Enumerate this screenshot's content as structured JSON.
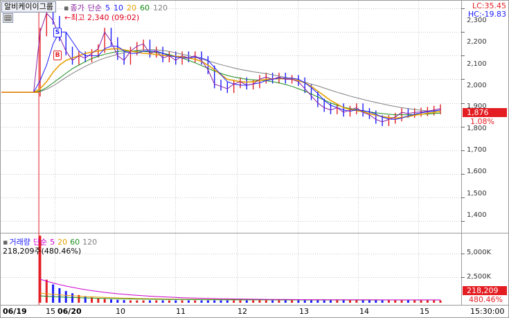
{
  "stock_name": "알비케이이그룹",
  "legend": {
    "main": "종가",
    "ma_type": "단순",
    "periods": [
      {
        "label": "5",
        "color": "#1a1aff"
      },
      {
        "label": "10",
        "color": "#1a1aff"
      },
      {
        "label": "20",
        "color": "#e6a000"
      },
      {
        "label": "60",
        "color": "#1a8c1a"
      },
      {
        "label": "120",
        "color": "#808080"
      }
    ],
    "main_color": "#8a1fa0"
  },
  "volume_legend": {
    "main": "거래량",
    "ma_type": "단순",
    "periods": [
      {
        "label": "5",
        "color": "#cc00cc"
      },
      {
        "label": "20",
        "color": "#e6a000"
      },
      {
        "label": "60",
        "color": "#1a8c1a"
      },
      {
        "label": "120",
        "color": "#808080"
      }
    ],
    "info": "218,209주(480.46%)"
  },
  "high_marker": "최고 2,340 (09:02)",
  "badges": {
    "sell": "S",
    "buy": "B"
  },
  "lc": "LC:35.45",
  "hc": "HC:-19.83",
  "price_axis": [
    "2,300",
    "2,200",
    "2,100",
    "2,000",
    "1,900",
    "1,800",
    "1,700",
    "1,600",
    "1,500",
    "1,400"
  ],
  "price_tag": {
    "value": "1,876",
    "change": "1.08%"
  },
  "volume_axis": [
    "5,000K",
    "2,500K"
  ],
  "volume_tag": {
    "value": "218,209",
    "change": "480.46%"
  },
  "x_axis": [
    {
      "label": "06/19",
      "bold": true
    },
    {
      "label": "15",
      "bold": false
    },
    {
      "label": "06/20",
      "bold": true
    },
    {
      "label": "10",
      "bold": false
    },
    {
      "label": "11",
      "bold": false
    },
    {
      "label": "12",
      "bold": false
    },
    {
      "label": "13",
      "bold": false
    },
    {
      "label": "14",
      "bold": false
    },
    {
      "label": "15",
      "bold": false
    }
  ],
  "clock": "15:30:00",
  "colors": {
    "up": "#e41d22",
    "down": "#1a1aff",
    "grid": "#c8c8c8",
    "axis": "#666666"
  },
  "chart_data": {
    "type": "line",
    "title": "",
    "ylim": [
      1350,
      2330
    ],
    "close": [
      1945,
      1945,
      1945,
      1945,
      1945,
      1945,
      2200,
      2280,
      2250,
      2180,
      2120,
      2080,
      2100,
      2090,
      2110,
      2130,
      2200,
      2160,
      2100,
      2080,
      2120,
      2140,
      2150,
      2110,
      2120,
      2090,
      2100,
      2080,
      2100,
      2090,
      2100,
      2080,
      2040,
      1980,
      1970,
      1960,
      1980,
      1990,
      1975,
      1980,
      2000,
      2010,
      2000,
      2010,
      2000,
      2000,
      1990,
      1960,
      1930,
      1900,
      1880,
      1870,
      1880,
      1860,
      1870,
      1880,
      1860,
      1850,
      1830,
      1820,
      1830,
      1840,
      1860,
      1855,
      1860,
      1862,
      1865,
      1870,
      1876
    ],
    "ma5": [
      1945,
      1945,
      1945,
      1945,
      1945,
      1945,
      1995,
      2060,
      2150,
      2200,
      2200,
      2160,
      2120,
      2100,
      2100,
      2100,
      2130,
      2140,
      2140,
      2120,
      2110,
      2110,
      2120,
      2120,
      2120,
      2110,
      2100,
      2095,
      2090,
      2090,
      2095,
      2090,
      2080,
      2050,
      2020,
      1990,
      1980,
      1975,
      1975,
      1980,
      1985,
      1995,
      2000,
      2005,
      2005,
      2005,
      2000,
      1985,
      1965,
      1940,
      1910,
      1890,
      1880,
      1870,
      1865,
      1870,
      1868,
      1862,
      1852,
      1840,
      1832,
      1830,
      1836,
      1845,
      1852,
      1858,
      1862,
      1866,
      1870
    ],
    "ma20": [
      1945,
      1945,
      1945,
      1945,
      1945,
      1945,
      1960,
      1990,
      2030,
      2060,
      2080,
      2090,
      2100,
      2110,
      2115,
      2120,
      2125,
      2128,
      2130,
      2125,
      2120,
      2115,
      2110,
      2108,
      2105,
      2102,
      2100,
      2098,
      2095,
      2090,
      2085,
      2075,
      2060,
      2040,
      2020,
      2000,
      1995,
      1990,
      1988,
      1990,
      1995,
      2000,
      2002,
      2003,
      2002,
      2000,
      1995,
      1985,
      1970,
      1950,
      1930,
      1910,
      1895,
      1880,
      1872,
      1868,
      1862,
      1855,
      1848,
      1842,
      1838,
      1836,
      1838,
      1842,
      1848,
      1852,
      1856,
      1860,
      1864
    ],
    "ma60": [
      1945,
      1945,
      1945,
      1945,
      1945,
      1945,
      1950,
      1965,
      1985,
      2005,
      2025,
      2045,
      2060,
      2075,
      2088,
      2098,
      2106,
      2112,
      2118,
      2120,
      2120,
      2120,
      2118,
      2116,
      2114,
      2110,
      2105,
      2098,
      2090,
      2080,
      2070,
      2058,
      2046,
      2035,
      2025,
      2016,
      2010,
      2005,
      2000,
      1998,
      1996,
      1994,
      1990,
      1985,
      1978,
      1970,
      1960,
      1950,
      1938,
      1925,
      1912,
      1900,
      1890,
      1882,
      1876,
      1872,
      1866,
      1862,
      1858,
      1855,
      1852,
      1850,
      1850,
      1850,
      1851,
      1852,
      1853,
      1855,
      1857
    ],
    "ma120": [
      1945,
      1945,
      1945,
      1945,
      1945,
      1945,
      1948,
      1958,
      1972,
      1990,
      2008,
      2025,
      2040,
      2055,
      2068,
      2080,
      2090,
      2098,
      2106,
      2112,
      2118,
      2122,
      2125,
      2126,
      2125,
      2122,
      2118,
      2112,
      2106,
      2100,
      2093,
      2086,
      2078,
      2070,
      2062,
      2055,
      2048,
      2042,
      2037,
      2032,
      2028,
      2024,
      2019,
      2014,
      2008,
      2002,
      1995,
      1988,
      1980,
      1972,
      1963,
      1954,
      1945,
      1937,
      1929,
      1922,
      1915,
      1908,
      1902,
      1896,
      1890,
      1885,
      1880,
      1876,
      1872,
      1869,
      1866,
      1864,
      1862
    ],
    "volume_peak_ratio": 0.85
  }
}
